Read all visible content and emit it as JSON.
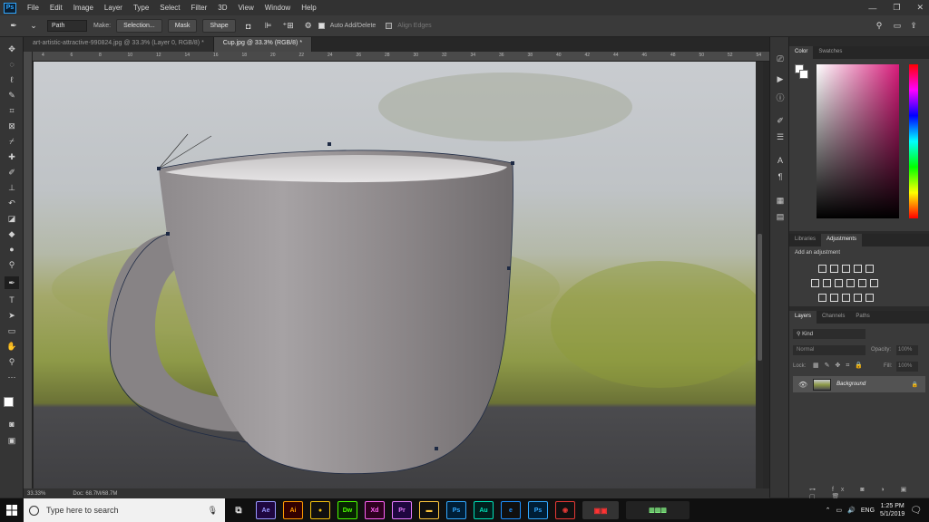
{
  "app": {
    "logo": "Ps"
  },
  "menu": [
    "File",
    "Edit",
    "Image",
    "Layer",
    "Type",
    "Select",
    "Filter",
    "3D",
    "View",
    "Window",
    "Help"
  ],
  "window_controls": {
    "minimize": "—",
    "restore": "❐",
    "close": "✕"
  },
  "options_bar": {
    "tool_mode": "Path",
    "make_label": "Make:",
    "selection_btn": "Selection...",
    "mask_btn": "Mask",
    "shape_btn": "Shape",
    "auto_add_delete": "Auto Add/Delete",
    "align_edges": "Align Edges"
  },
  "tabs": [
    {
      "label": "art-artistic-attractive-990824.jpg @ 33.3% (Layer 0, RGB/8) *",
      "active": false
    },
    {
      "label": "Cup.jpg @ 33.3% (RGB/8) *",
      "active": true
    }
  ],
  "ruler_ticks": [
    "4",
    "6",
    "8",
    "10",
    "12",
    "14",
    "16",
    "18",
    "20",
    "22",
    "24",
    "26",
    "28",
    "30",
    "32",
    "34",
    "36",
    "38",
    "40",
    "42",
    "44",
    "46",
    "48",
    "50",
    "52",
    "54"
  ],
  "status": {
    "zoom": "33.33%",
    "doc": "Doc: 68.7M/68.7M"
  },
  "panels": {
    "color_tabs": [
      "Color",
      "Swatches"
    ],
    "adjust_tabs": [
      "Libraries",
      "Adjustments"
    ],
    "add_adjustment": "Add an adjustment",
    "layers_tabs": [
      "Layers",
      "Channels",
      "Paths"
    ],
    "kind": "Kind",
    "blend_mode": "Normal",
    "opacity_label": "Opacity:",
    "opacity_value": "100%",
    "lock_label": "Lock:",
    "fill_label": "Fill:",
    "fill_value": "100%",
    "layer_name": "Background"
  },
  "colors": {
    "hue_top": "#ff0000",
    "accent": "#31a8ff",
    "picker_base": "#d81b7a"
  },
  "taskbar": {
    "search_placeholder": "Type here to search",
    "apps": [
      {
        "label": "Ae",
        "bg": "#1f0740",
        "fg": "#9999ff"
      },
      {
        "label": "Ai",
        "bg": "#330000",
        "fg": "#ff9a00"
      },
      {
        "label": "●",
        "bg": "#101010",
        "fg": "#f4c20d"
      },
      {
        "label": "Dw",
        "bg": "#072401",
        "fg": "#4cff00"
      },
      {
        "label": "Xd",
        "bg": "#2e001f",
        "fg": "#ff61f6"
      },
      {
        "label": "Pr",
        "bg": "#1f0740",
        "fg": "#e77cff"
      },
      {
        "label": "▬",
        "bg": "#101010",
        "fg": "#ffc83d"
      },
      {
        "label": "Ps",
        "bg": "#001e36",
        "fg": "#31a8ff"
      },
      {
        "label": "Au",
        "bg": "#00201d",
        "fg": "#00e4bb"
      },
      {
        "label": "e",
        "bg": "#101010",
        "fg": "#1e90ff"
      },
      {
        "label": "Ps",
        "bg": "#001e36",
        "fg": "#31a8ff"
      },
      {
        "label": "◉",
        "bg": "#101010",
        "fg": "#e53935"
      }
    ],
    "language": "ENG",
    "time": "1:25 PM",
    "date": "5/1/2019"
  }
}
